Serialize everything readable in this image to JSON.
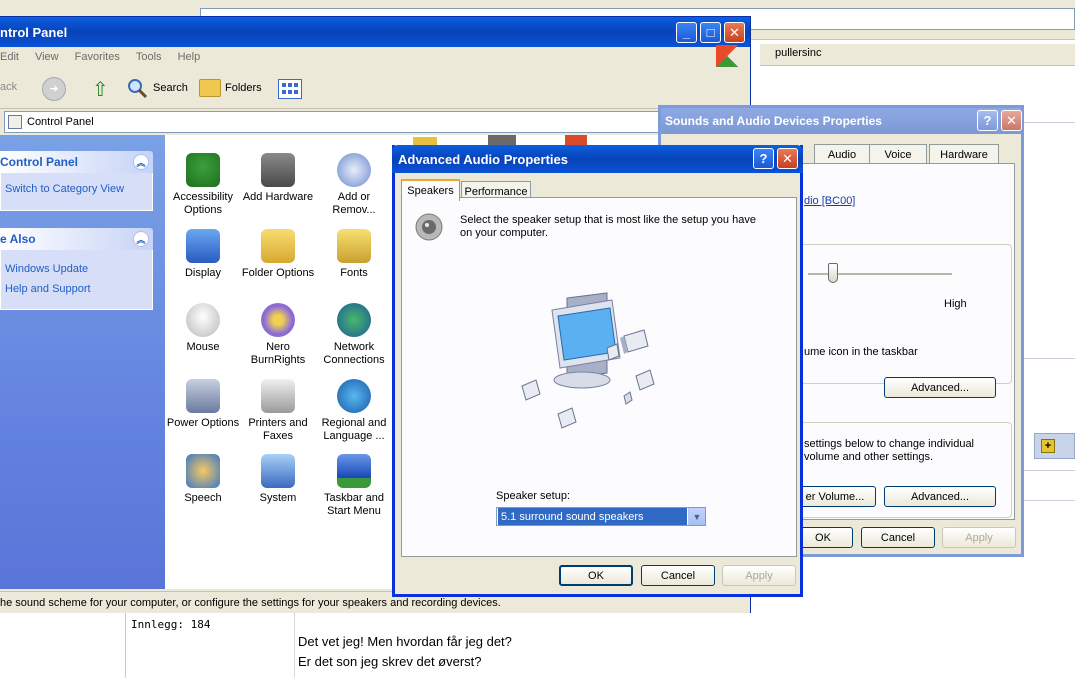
{
  "background": {
    "forum_user": "pullersinc",
    "post_meta": "Innlegg: 184",
    "post_lines": [
      "Det vet jeg! Men hvordan får jeg det?",
      "Er det son jeg skrev det øverst?"
    ]
  },
  "control_panel": {
    "title": "ntrol Panel",
    "menu": [
      "Edit",
      "View",
      "Favorites",
      "Tools",
      "Help"
    ],
    "toolbar": {
      "back_label": "ack",
      "search_label": "Search",
      "folders_label": "Folders"
    },
    "address": "Control Panel",
    "sidebar": {
      "panel1_title": "Control Panel",
      "panel1_link": "Switch to Category View",
      "panel2_title": "e Also",
      "panel2_links": [
        "Windows Update",
        "Help and Support"
      ]
    },
    "items": [
      {
        "label": "Accessibility Options",
        "icon": "accessibility-icon",
        "color": "#2d8a2d"
      },
      {
        "label": "Add Hardware",
        "icon": "add-hardware-icon",
        "color": "#6b6b6b"
      },
      {
        "label": "Add or Remov...",
        "icon": "add-remove-programs-icon",
        "color": "#5a8ad6"
      },
      {
        "label": "Display",
        "icon": "display-icon",
        "color": "#3c78d8"
      },
      {
        "label": "Folder Options",
        "icon": "folder-options-icon",
        "color": "#e8c14a"
      },
      {
        "label": "Fonts",
        "icon": "fonts-icon",
        "color": "#e0c040"
      },
      {
        "label": "Mouse",
        "icon": "mouse-icon",
        "color": "#d8d8d8"
      },
      {
        "label": "Nero BurnRights",
        "icon": "nero-icon",
        "color": "#8a6bd8"
      },
      {
        "label": "Network Connections",
        "icon": "network-icon",
        "color": "#2f8a4a"
      },
      {
        "label": "Power Options",
        "icon": "power-icon",
        "color": "#8a9ab8"
      },
      {
        "label": "Printers and Faxes",
        "icon": "printer-icon",
        "color": "#c9c9c9"
      },
      {
        "label": "Regional and Language ...",
        "icon": "globe-icon",
        "color": "#2e7fc8"
      },
      {
        "label": "Speech",
        "icon": "speech-icon",
        "color": "#e0a63a"
      },
      {
        "label": "System",
        "icon": "system-icon",
        "color": "#4a8ad8"
      },
      {
        "label": "Taskbar and Start Menu",
        "icon": "taskbar-icon",
        "color": "#2f5fc8"
      }
    ],
    "status": "he sound scheme for your computer, or configure the settings for your speakers and recording devices."
  },
  "sounds_dialog": {
    "title": "Sounds and Audio Devices Properties",
    "tabs": [
      "Audio",
      "Voice",
      "Hardware"
    ],
    "device_text": "dio [BC00]",
    "high_label": "High",
    "taskbar_text": "ume icon in the taskbar",
    "advanced1_label": "Advanced...",
    "settings_text_1": "settings below to change individual",
    "settings_text_2": "volume and other settings.",
    "volume_button": "er Volume...",
    "advanced2_label": "Advanced...",
    "ok_label": "OK",
    "cancel_label": "Cancel",
    "apply_label": "Apply"
  },
  "advanced_dialog": {
    "title": "Advanced Audio Properties",
    "tabs": [
      "Speakers",
      "Performance"
    ],
    "description": "Select the speaker setup that is most like the setup you have on your computer.",
    "speaker_setup_label": "Speaker setup:",
    "speaker_setup_value": "5.1 surround sound speakers",
    "ok_label": "OK",
    "cancel_label": "Cancel",
    "apply_label": "Apply"
  },
  "colors": {
    "xp_blue": "#0a53d8",
    "sidebar_blue": "#6484e0",
    "link_blue": "#215dc6",
    "selection": "#316ac5"
  }
}
